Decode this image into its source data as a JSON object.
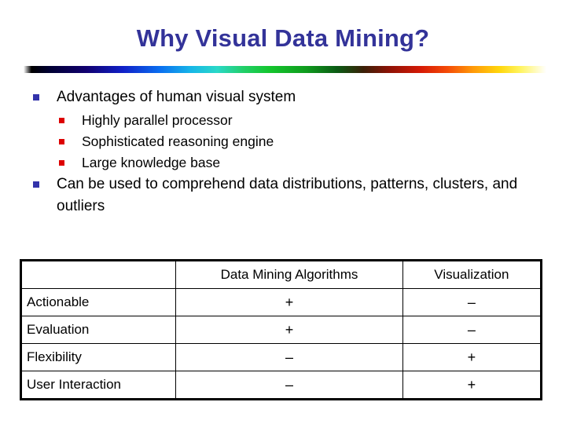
{
  "slide": {
    "title": "Why Visual Data Mining?",
    "title_color": "#333399",
    "bullet_l1_color": "#3333aa",
    "bullet_l2_color": "#dd0000"
  },
  "bullets": [
    {
      "level": 1,
      "text": "Advantages of human visual system"
    },
    {
      "level": 2,
      "text": "Highly parallel processor"
    },
    {
      "level": 2,
      "text": "Sophisticated reasoning engine"
    },
    {
      "level": 2,
      "text": "Large knowledge base"
    },
    {
      "level": 1,
      "text": "Can be used to comprehend data distributions, patterns, clusters, and outliers"
    }
  ],
  "table": {
    "headers": [
      "",
      "Data Mining Algorithms",
      "Visualization"
    ],
    "rows": [
      {
        "label": "Actionable",
        "dm": "+",
        "vis": "–"
      },
      {
        "label": "Evaluation",
        "dm": "+",
        "vis": "–"
      },
      {
        "label": "Flexibility",
        "dm": "–",
        "vis": "+"
      },
      {
        "label": "User Interaction",
        "dm": "–",
        "vis": "+"
      }
    ]
  }
}
